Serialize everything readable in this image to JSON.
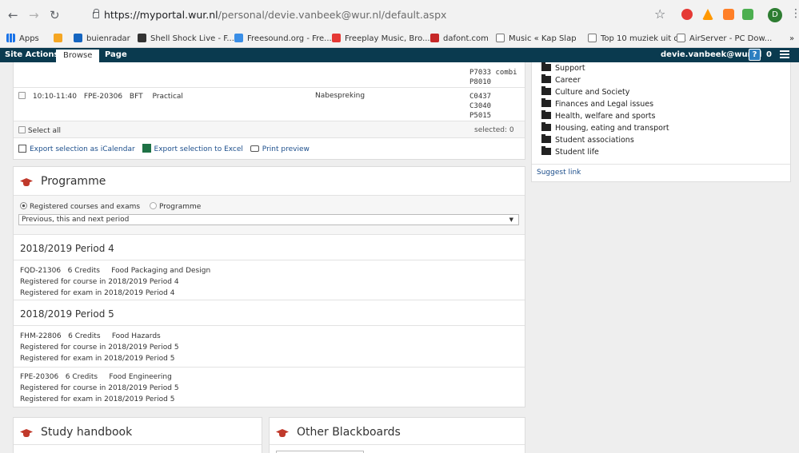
{
  "browser": {
    "url_host": "https://myportal.wur.nl",
    "url_path": "/personal/devie.vanbeek@wur.nl/default.aspx",
    "avatar_letter": "D",
    "bookmarks": [
      {
        "label": "Apps",
        "icon": "apps-grid-icon",
        "color": "#5f6368"
      },
      {
        "label": "",
        "icon": "orange-app-icon",
        "color": "#f5a623"
      },
      {
        "label": "buienradar",
        "icon": "buienradar-icon",
        "color": "#1565c0"
      },
      {
        "label": "Shell Shock Live - F...",
        "icon": "game-icon",
        "color": "#333333"
      },
      {
        "label": "Freesound.org - Fre...",
        "icon": "freesound-icon",
        "color": "#3a8ee6"
      },
      {
        "label": "Freeplay Music, Bro...",
        "icon": "freeplay-icon",
        "color": "#e53935"
      },
      {
        "label": "dafont.com",
        "icon": "dafont-icon",
        "color": "#c62828"
      },
      {
        "label": "Music « Kap Slap",
        "icon": "page-icon",
        "color": "#ffffff"
      },
      {
        "label": "Top 10 muziek uit d...",
        "icon": "page-icon",
        "color": "#ffffff"
      },
      {
        "label": "AirServer - PC Dow...",
        "icon": "page-icon",
        "color": "#ffffff"
      }
    ],
    "more_bookmarks": "»"
  },
  "ribbon": {
    "site_actions": "Site Actions",
    "browse": "Browse",
    "page": "Page",
    "user": "devie.vanbeek@wur.nl",
    "help": "?",
    "notifications": "0"
  },
  "schedule": {
    "partial_rooms": [
      "P7033 combi",
      "P8010"
    ],
    "row": {
      "time": "10:10-11:40",
      "code": "FPE-20306",
      "dept": "BFT",
      "type": "Practical",
      "note": "Nabespreking",
      "rooms": [
        "C0437",
        "C3040",
        "P5015"
      ]
    },
    "select_all": "Select all",
    "selected": "selected: 0",
    "export_ical": "Export selection as iCalendar",
    "export_excel": "Export selection to Excel",
    "print_preview": "Print preview"
  },
  "programme": {
    "title": "Programme",
    "radio_registered": "Registered courses and exams",
    "radio_programme": "Programme",
    "period_select": "Previous, this and next period",
    "periods": [
      {
        "name": "2018/2019 Period 4",
        "courses": [
          {
            "head": "FQD-21306   6 Credits     Food Packaging and Design",
            "course_reg": "Registered for course in 2018/2019 Period 4",
            "exam_reg": "Registered for exam in 2018/2019 Period 4"
          }
        ]
      },
      {
        "name": "2018/2019 Period 5",
        "courses": [
          {
            "head": "FHM-22806   6 Credits     Food Hazards",
            "course_reg": "Registered for course in 2018/2019 Period 5",
            "exam_reg": "Registered for exam in 2018/2019 Period 5"
          },
          {
            "head": "FPE-20306   6 Credits     Food Engineering",
            "course_reg": "Registered for course in 2018/2019 Period 5",
            "exam_reg": "Registered for exam in 2018/2019 Period 5"
          }
        ]
      }
    ]
  },
  "study_handbook": {
    "title": "Study handbook"
  },
  "other_blackboards": {
    "title": "Other Blackboards"
  },
  "categories": {
    "items": [
      "Support",
      "Career",
      "Culture and Society",
      "Finances and Legal issues",
      "Health, welfare and sports",
      "Housing, eating and transport",
      "Student associations",
      "Student life"
    ],
    "suggest": "Suggest link"
  }
}
